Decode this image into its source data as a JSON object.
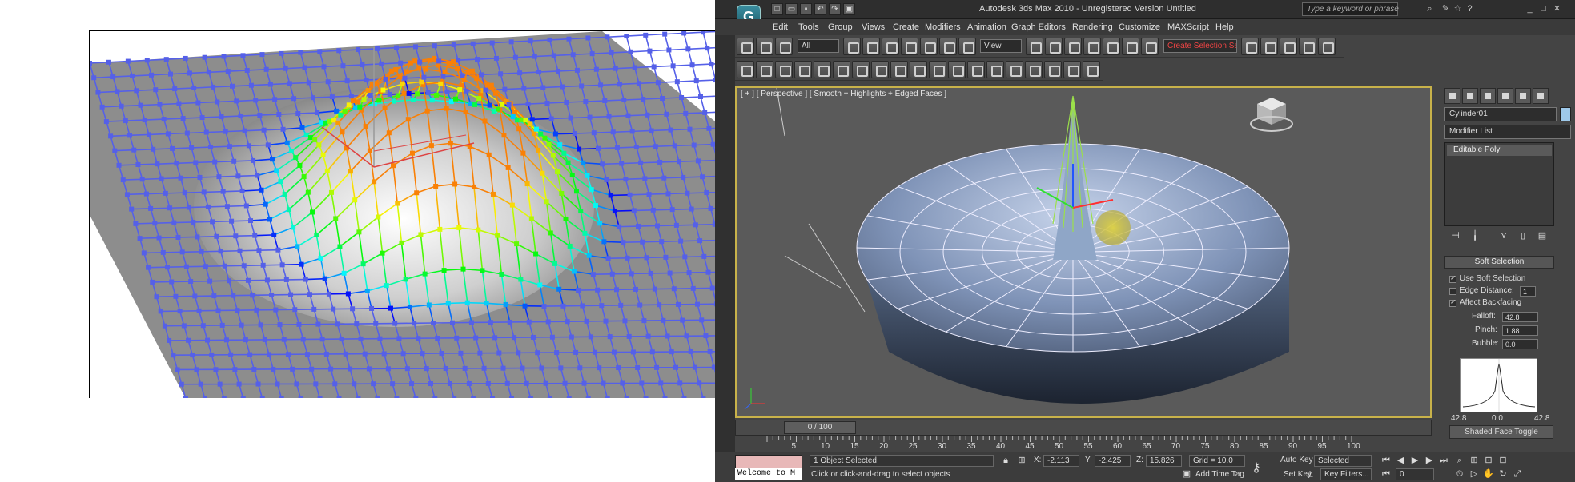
{
  "app": {
    "title": "Autodesk 3ds Max  2010  -  Unregistered Version   Untitled",
    "search_placeholder": "Type a keyword or phrase",
    "logo_icon": "3dsmax-logo-icon",
    "window_buttons": [
      "_",
      "□",
      "✕"
    ]
  },
  "menu": [
    "Edit",
    "Tools",
    "Group",
    "Views",
    "Create",
    "Modifiers",
    "Animation",
    "Graph Editors",
    "Rendering",
    "Customize",
    "MAXScript",
    "Help"
  ],
  "toolbar": {
    "filter_select": "All",
    "ref_coord_select": "View",
    "selection_set": "Create Selection Se"
  },
  "viewport": {
    "label": "[ + ] [ Perspective ] [ Smooth + Highlights + Edged Faces ]"
  },
  "command_panel": {
    "object_name": "Cylinder01",
    "modifier_list": "Modifier List",
    "stack_item": "Editable Poly",
    "rollout_title": "Soft Selection",
    "use_soft_selection": "Use Soft Selection",
    "edge_distance": "Edge Distance:",
    "edge_distance_value": "1",
    "affect_backfacing": "Affect Backfacing",
    "falloff_label": "Falloff:",
    "falloff_value": "42.8",
    "pinch_label": "Pinch:",
    "pinch_value": "1.88",
    "bubble_label": "Bubble:",
    "bubble_value": "0.0",
    "curve_left": "42.8",
    "curve_mid": "0.0",
    "curve_right": "42.8",
    "shaded_face_toggle": "Shaded Face Toggle"
  },
  "timeline": {
    "slider_label": "0 / 100",
    "ticks": [
      "5",
      "10",
      "15",
      "20",
      "25",
      "30",
      "35",
      "40",
      "45",
      "50",
      "55",
      "60",
      "65",
      "70",
      "75",
      "80",
      "85",
      "90",
      "95",
      "100"
    ]
  },
  "status": {
    "listener": "Welcome to M",
    "selection": "1 Object Selected",
    "prompt": "Click or click-and-drag to select objects",
    "x_label": "X:",
    "x_value": "-2.113",
    "y_label": "Y:",
    "y_value": "-2.425",
    "z_label": "Z:",
    "z_value": "15.826",
    "grid": "Grid = 10.0",
    "auto_key": "Auto Key",
    "set_key": "Set Key",
    "selected": "Selected",
    "key_filters": "Key Filters...",
    "add_time_tag": "Add Time Tag",
    "frame": "0"
  }
}
